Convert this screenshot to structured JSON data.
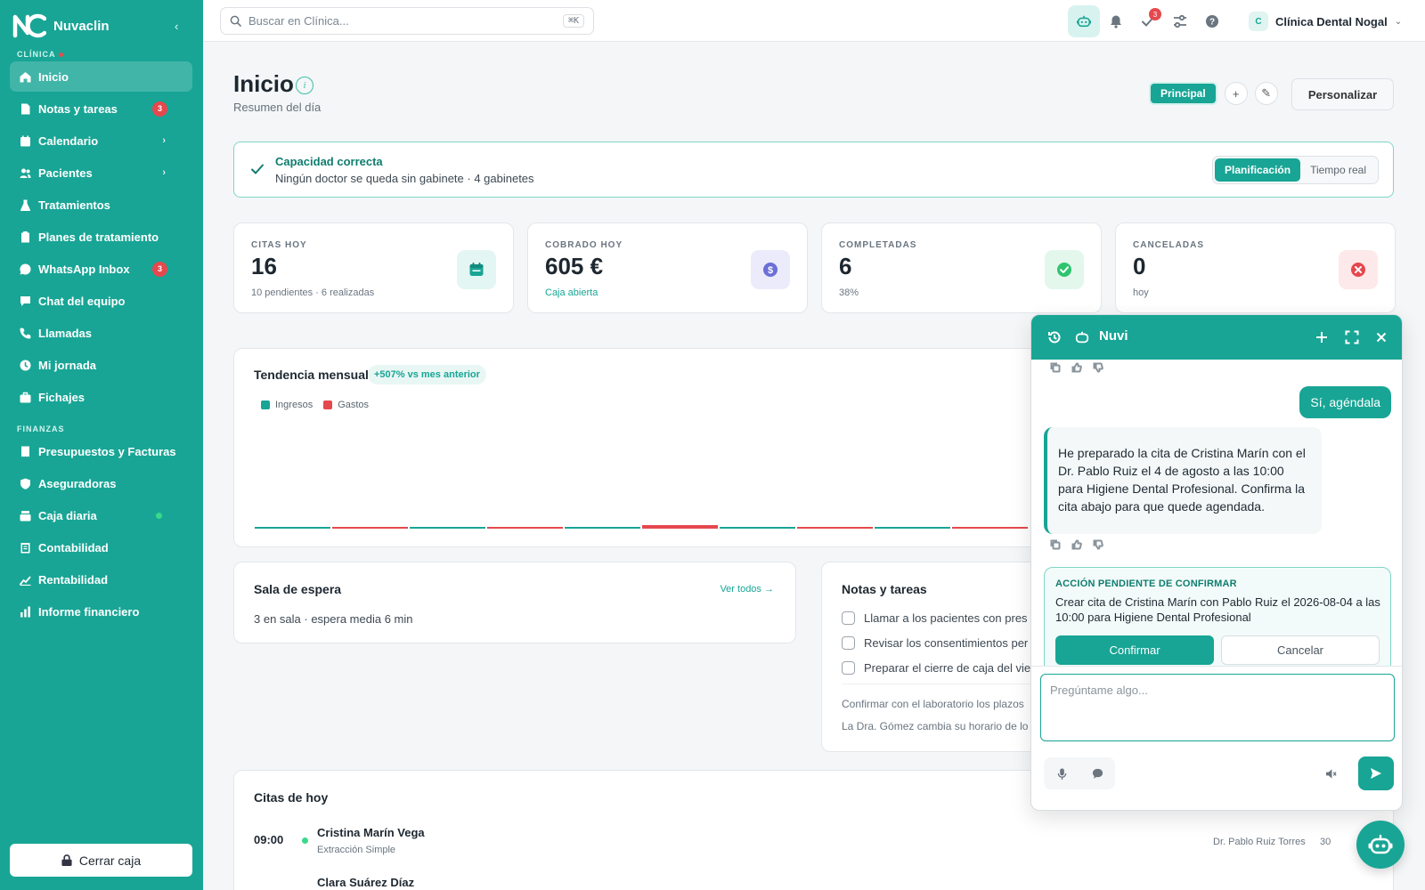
{
  "app": {
    "name": "Nuvaclin",
    "brand_color": "#18a595"
  },
  "sidebar": {
    "section_clinic": "CLÍNICA",
    "section_finance": "FINANZAS",
    "items": [
      {
        "label": "Inicio",
        "icon": "home-icon",
        "active": true
      },
      {
        "label": "Notas y tareas",
        "icon": "note-icon",
        "badge": "3"
      },
      {
        "label": "Calendario",
        "icon": "calendar-icon",
        "chevron": "›"
      },
      {
        "label": "Pacientes",
        "icon": "users-icon",
        "chevron": "›"
      },
      {
        "label": "Tratamientos",
        "icon": "flask-icon"
      },
      {
        "label": "Planes de tratamiento",
        "icon": "clipboard-icon"
      },
      {
        "label": "WhatsApp Inbox",
        "icon": "whatsapp-icon",
        "badge": "3"
      },
      {
        "label": "Chat del equipo",
        "icon": "chat-icon"
      },
      {
        "label": "Llamadas",
        "icon": "phone-icon"
      },
      {
        "label": "Mi jornada",
        "icon": "clock-icon"
      },
      {
        "label": "Fichajes",
        "icon": "briefcase-icon"
      }
    ],
    "finance_items": [
      {
        "label": "Presupuestos y Facturas",
        "icon": "invoice-icon"
      },
      {
        "label": "Aseguradoras",
        "icon": "shield-icon"
      },
      {
        "label": "Caja diaria",
        "icon": "cash-register-icon",
        "status": "online"
      },
      {
        "label": "Contabilidad",
        "icon": "ledger-icon"
      },
      {
        "label": "Rentabilidad",
        "icon": "trend-icon"
      },
      {
        "label": "Informe financiero",
        "icon": "bar-chart-icon"
      }
    ],
    "close_cash_label": "Cerrar caja"
  },
  "topbar": {
    "search_placeholder": "Buscar en Clínica...",
    "search_shortcut": "⌘K",
    "tasks_badge": "3",
    "clinic_initial": "C",
    "clinic_name": "Clínica Dental Nogal"
  },
  "page": {
    "title": "Inicio",
    "subtitle": "Resumen del día",
    "dashboard_tab": "Principal",
    "add_label": "+",
    "edit_label": "✎",
    "customize_label": "Personalizar"
  },
  "capacity": {
    "title": "Capacidad correcta",
    "subtitle": "Ningún doctor se queda sin gabinete · 4 gabinetes",
    "mode_planning": "Planificación",
    "mode_realtime": "Tiempo real"
  },
  "kpis": [
    {
      "label": "CITAS HOY",
      "value": "16",
      "sub": "10 pendientes · 6 realizadas",
      "icon": "calendar-icon",
      "color": "#18a595",
      "bg": "#e3f6f3"
    },
    {
      "label": "COBRADO HOY",
      "value": "605 €",
      "sub": "Caja abierta",
      "icon": "dollar-icon",
      "color": "#6b6fd6",
      "bg": "#ebebfb"
    },
    {
      "label": "COMPLETADAS",
      "value": "6",
      "sub": "38%",
      "icon": "check-circle-icon",
      "color": "#2fc46e",
      "bg": "#e4f7ec"
    },
    {
      "label": "CANCELADAS",
      "value": "0",
      "sub": "hoy",
      "icon": "x-circle-icon",
      "color": "#e5484d",
      "bg": "#fde9ea"
    }
  ],
  "trend": {
    "title": "Tendencia mensual",
    "pill": "+507% vs mes anterior"
  },
  "chart_data": {
    "type": "bar",
    "series": [
      {
        "name": "Ingresos",
        "color": "#18a595",
        "values": [
          0,
          0,
          0,
          0,
          0
        ]
      },
      {
        "name": "Gastos",
        "color": "#e5484d",
        "values": [
          0,
          0,
          1,
          0,
          0
        ]
      }
    ],
    "legend": "top-left"
  },
  "waiting_room": {
    "title": "Sala de espera",
    "link": "Ver todos →",
    "text": "3 en sala · espera media 6 min"
  },
  "notes": {
    "title": "Notas y tareas",
    "tasks": [
      "Llamar a los pacientes con pres",
      "Revisar los consentimientos per",
      "Preparar el cierre de caja del vie"
    ],
    "notes": [
      "Confirmar con el laboratorio los plazos",
      "La Dra. Gómez cambia su horario de lo"
    ]
  },
  "appointments": {
    "title": "Citas de hoy",
    "rows": [
      {
        "time": "09:00",
        "name": "Cristina Marín Vega",
        "treatment": "Extracción Simple",
        "doctor": "Dr. Pablo Ruiz Torres",
        "duration": "30"
      },
      {
        "time": "",
        "name": "Clara Suárez Díaz",
        "treatment": "",
        "doctor": "",
        "duration": ""
      }
    ]
  },
  "chat": {
    "title": "Nuvi",
    "user_message": "Sí, agéndala",
    "bot_message": "He preparado la cita de Cristina Marín con el Dr. Pablo Ruiz el 4 de agosto a las 10:00 para Higiene Dental Profesional. Confirma la cita abajo para que quede agendada.",
    "pending_label": "ACCIÓN PENDIENTE DE CONFIRMAR",
    "pending_text": "Crear cita de Cristina Marín con Pablo Ruiz el 2026-08-04 a las 10:00 para Higiene Dental Profesional",
    "confirm_label": "Confirmar",
    "cancel_label": "Cancelar",
    "input_placeholder": "Pregúntame algo..."
  }
}
